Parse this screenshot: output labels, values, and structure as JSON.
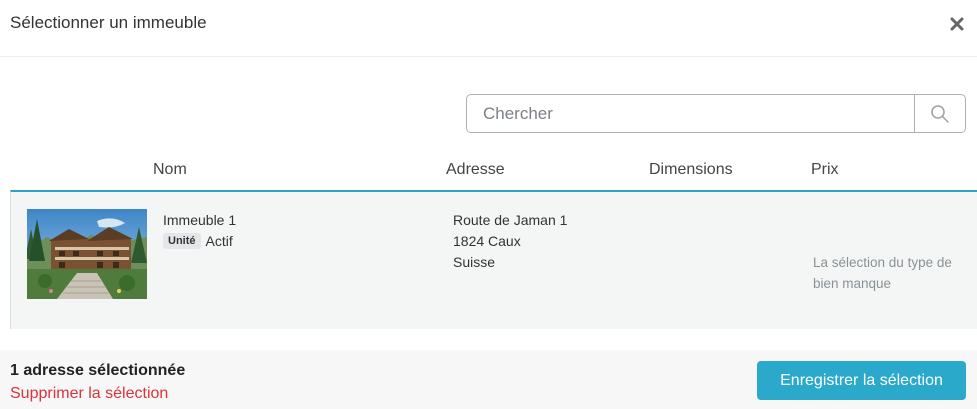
{
  "modal": {
    "title": "Sélectionner un immeuble"
  },
  "search": {
    "placeholder": "Chercher",
    "value": ""
  },
  "table": {
    "columns": [
      "Nom",
      "Adresse",
      "Dimensions",
      "Prix"
    ],
    "rows": [
      {
        "name": "Immeuble 1",
        "badge": "Unité",
        "status": "Actif",
        "address": [
          "Route de Jaman 1",
          "1824 Caux",
          "Suisse"
        ],
        "dimensions": "",
        "price": "La sélection du type de bien manque",
        "selected": true
      }
    ]
  },
  "footer": {
    "selected_count": "1 adresse sélectionnée",
    "clear_label": "Supprimer la sélection",
    "save_label": "Enregistrer la sélection"
  },
  "colors": {
    "accent": "#2aa9cb",
    "danger": "#d8343a",
    "row_background": "#f4f6f6"
  },
  "icons": {
    "close": "close-icon",
    "search": "search-icon"
  }
}
